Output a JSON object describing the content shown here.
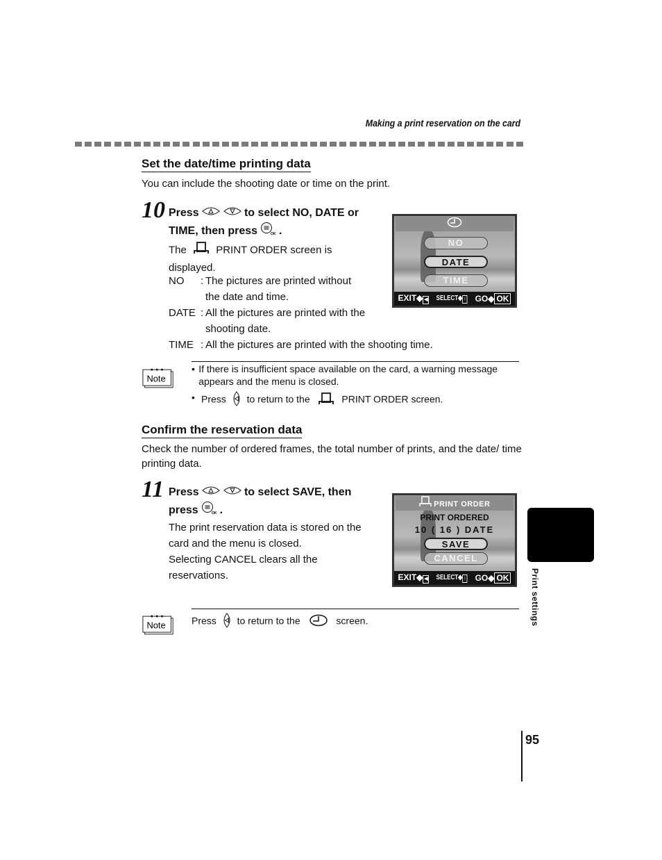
{
  "header": {
    "running_title": "Making a print reservation on the card"
  },
  "section1": {
    "title": "Set the date/time printing data",
    "intro": "You can include the shooting date or time on the print.",
    "step": {
      "number": "10",
      "head_press": "Press",
      "head_mid": "to select NO, DATE or",
      "head_line2": "TIME, then press",
      "head_end": ".",
      "desc_pre": "The",
      "desc_post": "PRINT ORDER screen is",
      "desc_line2": "displayed.",
      "definitions": [
        {
          "term": "NO",
          "colon": ":",
          "lines": [
            "The pictures are printed without",
            "the date and time."
          ]
        },
        {
          "term": "DATE",
          "colon": ":",
          "lines": [
            "All the pictures are printed with the",
            "shooting date."
          ]
        },
        {
          "term": "TIME",
          "colon": ":",
          "lines": [
            "All the pictures are printed with the shooting time."
          ]
        }
      ]
    },
    "lcd": {
      "title_icon": "clock-icon",
      "options": [
        {
          "label": "NO",
          "state": "dim"
        },
        {
          "label": "DATE",
          "state": "selected"
        },
        {
          "label": "TIME",
          "state": "dim"
        }
      ],
      "footer": {
        "exit": "EXIT",
        "select": "SELECT",
        "go": "GO",
        "ok": "OK"
      }
    },
    "note": {
      "badge": "Note",
      "items": [
        {
          "bullet": "•",
          "text": "If there is insufficient space available on the card, a warning message appears and the menu is closed."
        },
        {
          "bullet": "•",
          "pre": "Press",
          "mid": "to return to the",
          "post": "PRINT ORDER screen."
        }
      ]
    }
  },
  "section2": {
    "title": "Confirm the reservation data",
    "intro": "Check the number of ordered frames, the total number of prints, and the date/ time printing data.",
    "step": {
      "number": "11",
      "head_press": "Press",
      "head_mid": "to select SAVE, then",
      "head_line2": "press",
      "head_end": ".",
      "desc_lines": [
        "The print reservation data is stored on the",
        "card and the menu is closed.",
        "Selecting CANCEL clears all the",
        "reservations."
      ]
    },
    "lcd": {
      "title": "PRINT ORDER",
      "status": "PRINT ORDERED",
      "summary": "10 ( 16 ) DATE",
      "options": [
        {
          "label": "SAVE",
          "state": "selected"
        },
        {
          "label": "CANCEL",
          "state": "dim"
        }
      ],
      "footer": {
        "exit": "EXIT",
        "select": "SELECT",
        "go": "GO",
        "ok": "OK"
      }
    },
    "note": {
      "badge": "Note",
      "pre": "Press",
      "mid": "to return to the",
      "post": "screen."
    }
  },
  "side_tab": {
    "label": "Print settings"
  },
  "page_number": "95"
}
